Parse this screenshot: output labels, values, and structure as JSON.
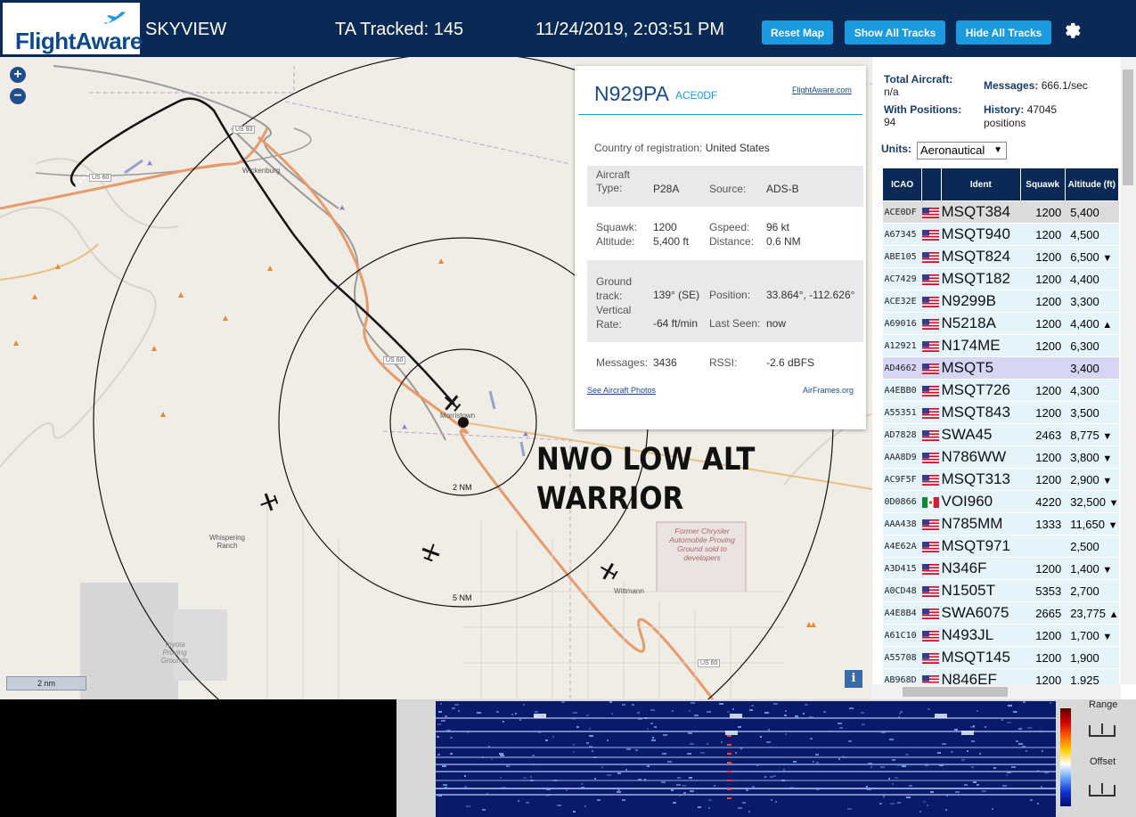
{
  "header": {
    "logo": "FlightAware",
    "app_name": "SKYVIEW",
    "tracked": "TA Tracked: 145",
    "datetime": "11/24/2019, 2:03:51 PM",
    "reset_label": "Reset Map",
    "show_label": "Show All Tracks",
    "hide_label": "Hide All Tracks"
  },
  "map": {
    "scale": "2 nm",
    "ring_small": "2 NM",
    "ring_large": "5 NM",
    "overlay_line1": "NWO LOW ALT",
    "overlay_line2": "WARRIOR",
    "places": {
      "wickenburg": "Wickenburg",
      "morristown": "Morristown",
      "wittmann": "Wittmann",
      "whispering": "Whispering Ranch",
      "toyota": "Toyota Proving Grounds",
      "chrysler": "Former Chrysler Automobile Proving Ground sold to developers",
      "us60a": "US 60",
      "us60b": "US 60",
      "us60c": "US 60",
      "us93": "US 93"
    }
  },
  "popup": {
    "ident": "N929PA",
    "icao": "ACE0DF",
    "fa_link": "FlightAware.com",
    "country_label": "Country of registration:",
    "country": "United States",
    "type_label": "Aircraft Type:",
    "type": "P28A",
    "source_label": "Source:",
    "source": "ADS-B",
    "squawk_label": "Squawk:",
    "squawk": "1200",
    "gspeed_label": "Gspeed:",
    "gspeed": "96 kt",
    "altitude_label": "Altitude:",
    "altitude": "5,400 ft",
    "distance_label": "Distance:",
    "distance": "0.6 NM",
    "track_label": "Ground track:",
    "track": "139° (SE)",
    "position_label": "Position:",
    "position": "33.864°, -112.626°",
    "vrate_label": "Vertical Rate:",
    "vrate": "-64 ft/min",
    "lastseen_label": "Last Seen:",
    "lastseen": "now",
    "messages_label": "Messages:",
    "messages": "3436",
    "rssi_label": "RSSI:",
    "rssi": "-2.6 dBFS",
    "photos_link": "See Aircraft Photos",
    "airframes_link": "AirFrames.org"
  },
  "sidebar": {
    "total_label": "Total Aircraft:",
    "total": "n/a",
    "messages_label": "Messages:",
    "messages": "666.1/sec",
    "positions_label": "With Positions:",
    "positions": "94",
    "history_label": "History:",
    "history": "47045 positions",
    "units_label": "Units:",
    "units_value": "Aeronautical",
    "columns": [
      "ICAO",
      "",
      "Ident",
      "Squawk",
      "Altitude (ft)"
    ],
    "rows": [
      {
        "icao": "ACE0DF",
        "flag": "us",
        "ident": "MSQT384",
        "squawk": "1200",
        "alt": "5,400",
        "trend": ""
      },
      {
        "icao": "A67345",
        "flag": "us",
        "ident": "MSQT940",
        "squawk": "1200",
        "alt": "4,500",
        "trend": ""
      },
      {
        "icao": "ABE105",
        "flag": "us",
        "ident": "MSQT824",
        "squawk": "1200",
        "alt": "6,500",
        "trend": "▼"
      },
      {
        "icao": "AC7429",
        "flag": "us",
        "ident": "MSQT182",
        "squawk": "1200",
        "alt": "4,400",
        "trend": ""
      },
      {
        "icao": "ACE32E",
        "flag": "us",
        "ident": "N9299B",
        "squawk": "1200",
        "alt": "3,300",
        "trend": ""
      },
      {
        "icao": "A69016",
        "flag": "us",
        "ident": "N5218A",
        "squawk": "1200",
        "alt": "4,400",
        "trend": "▲"
      },
      {
        "icao": "A12921",
        "flag": "us",
        "ident": "N174ME",
        "squawk": "1200",
        "alt": "6,300",
        "trend": ""
      },
      {
        "icao": "AD4662",
        "flag": "us",
        "ident": "MSQT5",
        "squawk": "",
        "alt": "3,400",
        "trend": ""
      },
      {
        "icao": "A4EBB0",
        "flag": "us",
        "ident": "MSQT726",
        "squawk": "1200",
        "alt": "4,300",
        "trend": ""
      },
      {
        "icao": "A55351",
        "flag": "us",
        "ident": "MSQT843",
        "squawk": "1200",
        "alt": "3,500",
        "trend": ""
      },
      {
        "icao": "AD7828",
        "flag": "us",
        "ident": "SWA45",
        "squawk": "2463",
        "alt": "8,775",
        "trend": "▼"
      },
      {
        "icao": "AAA8D9",
        "flag": "us",
        "ident": "N786WW",
        "squawk": "1200",
        "alt": "3,800",
        "trend": "▼"
      },
      {
        "icao": "AC9F5F",
        "flag": "us",
        "ident": "MSQT313",
        "squawk": "1200",
        "alt": "2,900",
        "trend": "▼"
      },
      {
        "icao": "0D0866",
        "flag": "mx",
        "ident": "VOI960",
        "squawk": "4220",
        "alt": "32,500",
        "trend": "▼"
      },
      {
        "icao": "AAA438",
        "flag": "us",
        "ident": "N785MM",
        "squawk": "1333",
        "alt": "11,650",
        "trend": "▼"
      },
      {
        "icao": "A4E62A",
        "flag": "us",
        "ident": "MSQT971",
        "squawk": "",
        "alt": "2,500",
        "trend": ""
      },
      {
        "icao": "A3D415",
        "flag": "us",
        "ident": "N346F",
        "squawk": "1200",
        "alt": "1,400",
        "trend": "▼"
      },
      {
        "icao": "A0CD48",
        "flag": "us",
        "ident": "N1505T",
        "squawk": "5353",
        "alt": "2,700",
        "trend": ""
      },
      {
        "icao": "A4E8B4",
        "flag": "us",
        "ident": "SWA6075",
        "squawk": "2665",
        "alt": "23,775",
        "trend": "▲"
      },
      {
        "icao": "A61C10",
        "flag": "us",
        "ident": "N493JL",
        "squawk": "1200",
        "alt": "1,700",
        "trend": "▼"
      },
      {
        "icao": "A55708",
        "flag": "us",
        "ident": "MSQT145",
        "squawk": "1200",
        "alt": "1,900",
        "trend": ""
      },
      {
        "icao": "AB968D",
        "flag": "us",
        "ident": "N846EF",
        "squawk": "1200",
        "alt": "1,925",
        "trend": ""
      }
    ]
  },
  "spectrum": {
    "range_label": "Range",
    "offset_label": "Offset"
  },
  "colors": {
    "header_bg": "#0a2a55",
    "button_bg": "#1a9be0",
    "table_row": "#e5f3fb",
    "selected_row": "#dcdcdc"
  }
}
